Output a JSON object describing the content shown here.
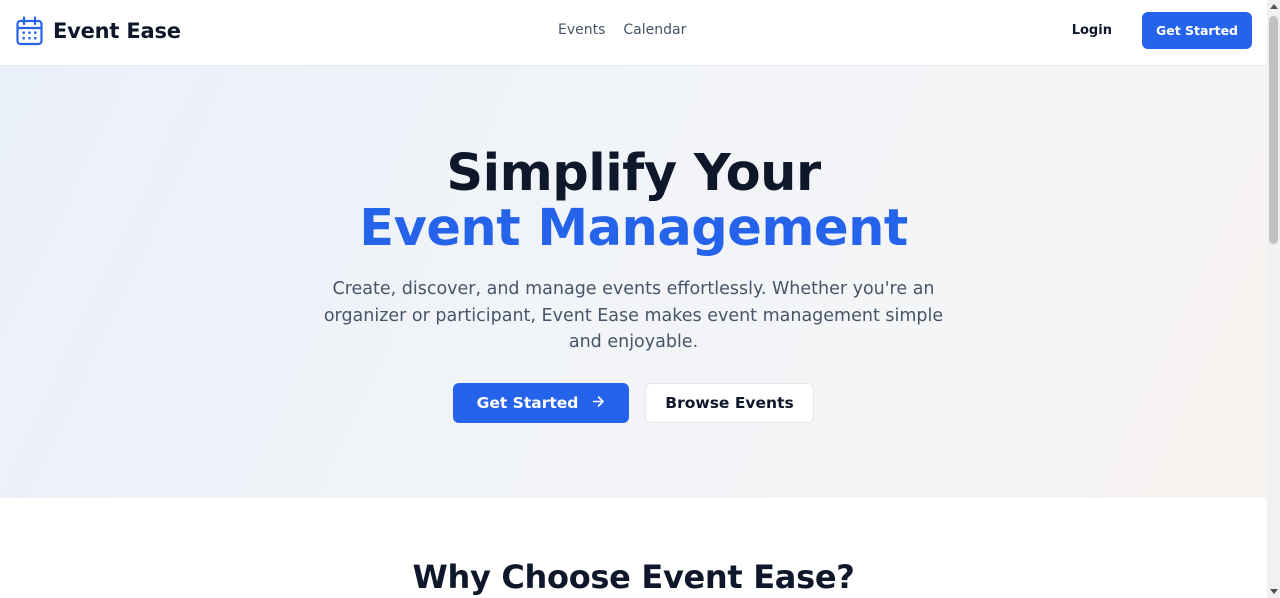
{
  "brand": {
    "name": "Event Ease",
    "icon": "calendar-icon",
    "accent_color": "#2563eb"
  },
  "nav": {
    "links": [
      "Events",
      "Calendar"
    ],
    "login_label": "Login",
    "cta_label": "Get Started"
  },
  "hero": {
    "title_line1": "Simplify Your",
    "title_line2": "Event Management",
    "subtitle": "Create, discover, and manage events effortlessly. Whether you're an organizer or participant, Event Ease makes event management simple and enjoyable.",
    "primary_cta": "Get Started",
    "primary_cta_icon": "arrow-right-icon",
    "secondary_cta": "Browse Events"
  },
  "features": {
    "title": "Why Choose Event Ease?"
  }
}
